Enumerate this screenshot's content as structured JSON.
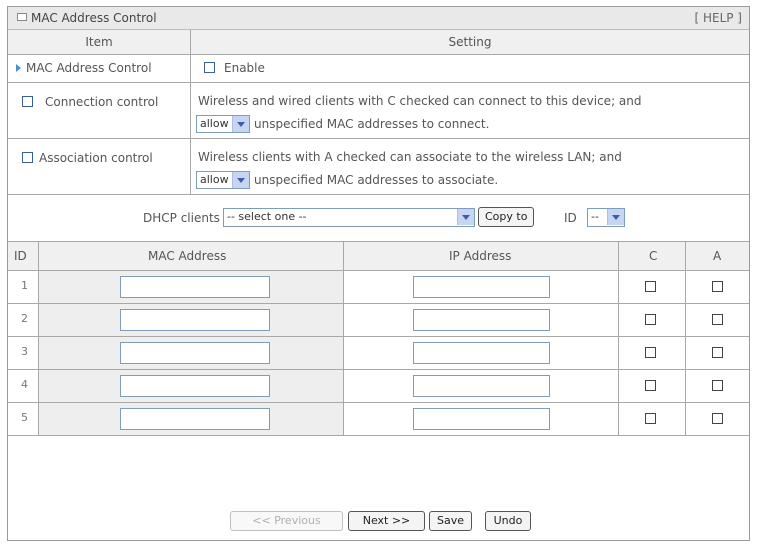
{
  "panel": {
    "title": "MAC Address Control",
    "help": "[ HELP ]"
  },
  "header": {
    "item": "Item",
    "setting": "Setting"
  },
  "mac_control": {
    "label": "MAC Address Control",
    "enable_label": "Enable"
  },
  "connection": {
    "label": "Connection control",
    "line1": "Wireless and wired clients with C checked can connect to this device; and",
    "select_value": "allow",
    "line2": "unspecified MAC addresses to connect."
  },
  "association": {
    "label": "Association control",
    "line1": "Wireless clients with A checked can associate to the wireless LAN; and",
    "select_value": "allow",
    "line2": "unspecified MAC addresses to associate."
  },
  "dhcp": {
    "label": "DHCP clients",
    "select_value": "-- select one --",
    "copy_button": "Copy to",
    "id_label": "ID",
    "id_value": "--"
  },
  "table": {
    "columns": [
      "ID",
      "MAC Address",
      "IP Address",
      "C",
      "A"
    ],
    "rows": [
      {
        "id": "1",
        "mac": "",
        "ip": ""
      },
      {
        "id": "2",
        "mac": "",
        "ip": ""
      },
      {
        "id": "3",
        "mac": "",
        "ip": ""
      },
      {
        "id": "4",
        "mac": "",
        "ip": ""
      },
      {
        "id": "5",
        "mac": "",
        "ip": ""
      }
    ]
  },
  "buttons": {
    "previous": "<< Previous",
    "next": "Next >>",
    "save": "Save",
    "undo": "Undo"
  }
}
